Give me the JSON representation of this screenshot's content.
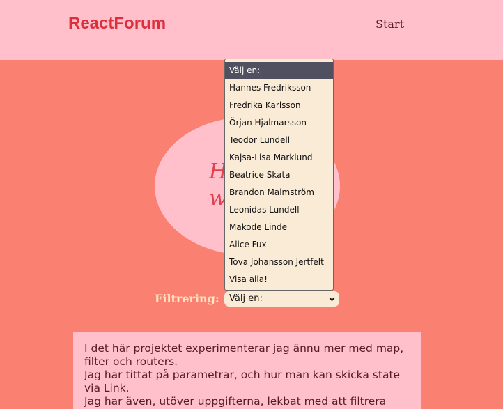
{
  "header": {
    "logo": "ReactForum",
    "nav_start": "Start"
  },
  "hero": {
    "script_line1": "H",
    "script_line2": "w"
  },
  "filter": {
    "label": "Filtrering:",
    "selected": "Välj en:",
    "options": [
      "Välj en:",
      "Hannes Fredriksson",
      "Fredrika Karlsson",
      "Örjan Hjalmarsson",
      "Teodor Lundell",
      "Kajsa-Lisa Marklund",
      "Beatrice Skata",
      "Brandon Malmström",
      "Leonidas Lundell",
      "Makode Linde",
      "Alice Fux",
      "Tova Johansson Jertfelt",
      "Visa alla!"
    ]
  },
  "description": {
    "lines": [
      "I det här projektet experimenterar jag ännu mer med map, filter och routers.",
      "Jag har tittat på parametrar, och hur man kan skicka state via Link.",
      "Jag har även, utöver uppgifterna, lekbat med att filtrera"
    ]
  }
}
